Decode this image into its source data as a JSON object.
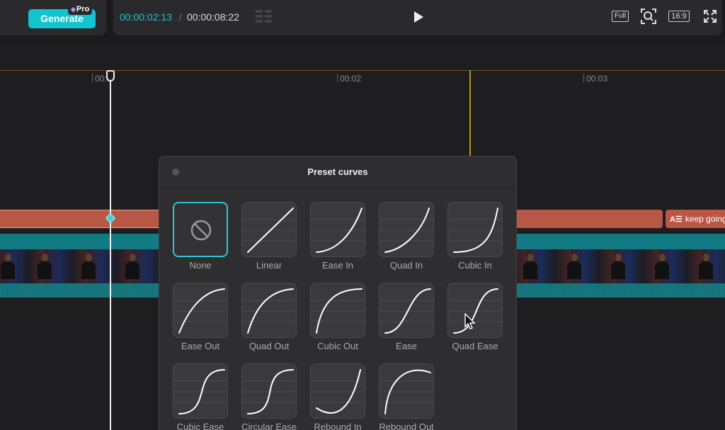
{
  "toolbar": {
    "generate_label": "Generate",
    "pro_label": "Pro",
    "current_time": "00:00:02:13",
    "separator": "/",
    "total_time": "00:00:08:22",
    "full_label": "Full",
    "ratio_label": "16:9"
  },
  "timeline": {
    "ticks": [
      "00:0",
      "00:02",
      "00:03"
    ],
    "caption_text": "keep going",
    "caption_icon": "A☰"
  },
  "panel": {
    "title": "Preset curves",
    "curves": [
      "None",
      "Linear",
      "Ease In",
      "Quad In",
      "Cubic In",
      "Ease Out",
      "Quad Out",
      "Cubic Out",
      "Ease",
      "Quad Ease",
      "Cubic Ease",
      "Circular Ease",
      "Rebound In",
      "Rebound Out"
    ],
    "selected": "None"
  },
  "colors": {
    "accent": "#12c4d0",
    "caption": "#b85746",
    "video_track": "#127a82",
    "ruler_marker": "#b3951f"
  }
}
